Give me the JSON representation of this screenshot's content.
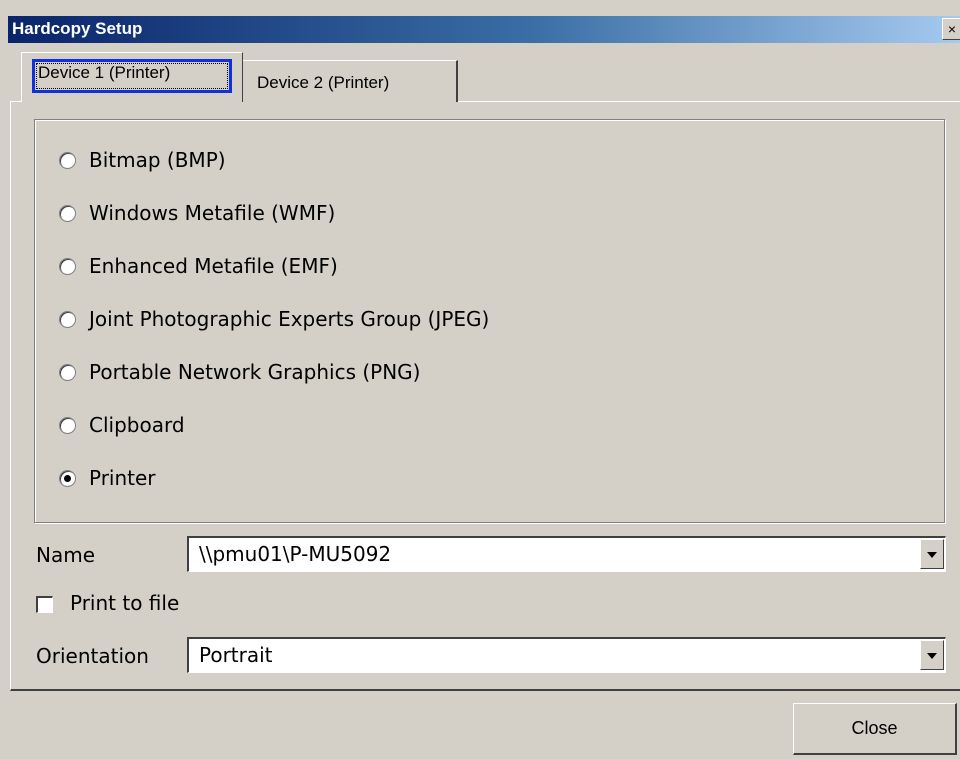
{
  "window": {
    "title": "Hardcopy Setup",
    "close_glyph": "×"
  },
  "tabs": [
    {
      "label": "Device 1 (Printer)",
      "selected": true
    },
    {
      "label": "Device 2 (Printer)",
      "selected": false
    }
  ],
  "output_options": [
    {
      "label": "Bitmap (BMP)",
      "checked": false
    },
    {
      "label": "Windows Metafile (WMF)",
      "checked": false
    },
    {
      "label": "Enhanced Metafile (EMF)",
      "checked": false
    },
    {
      "label": "Joint Photographic Experts Group (JPEG)",
      "checked": false
    },
    {
      "label": "Portable Network Graphics (PNG)",
      "checked": false
    },
    {
      "label": "Clipboard",
      "checked": false
    },
    {
      "label": "Printer",
      "checked": true
    }
  ],
  "name": {
    "label": "Name",
    "value": "\\\\pmu01\\P-MU5092"
  },
  "print_to_file": {
    "label": "Print to file",
    "checked": false
  },
  "orientation": {
    "label": "Orientation",
    "value": "Portrait"
  },
  "buttons": {
    "close": "Close"
  },
  "colors": {
    "titlebar_start": "#0a246a",
    "titlebar_end": "#a6caf0",
    "face": "#d4d0c8",
    "focus": "#1030e0"
  }
}
